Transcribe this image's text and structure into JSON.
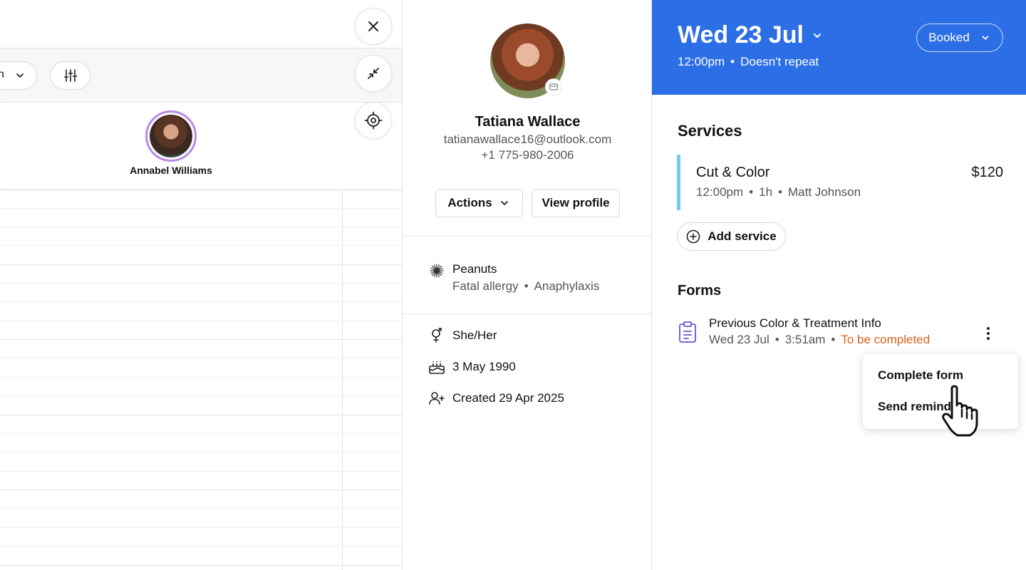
{
  "calendar": {
    "view_label": "h",
    "staff": [
      {
        "name": "Annabel Williams"
      }
    ]
  },
  "client": {
    "name": "Tatiana Wallace",
    "email": "tatianawallace16@outlook.com",
    "phone": "+1 775-980-2006",
    "actions_label": "Actions",
    "view_profile_label": "View profile",
    "allergy": {
      "name": "Peanuts",
      "severity": "Fatal allergy",
      "reaction": "Anaphylaxis"
    },
    "pronouns": "She/Her",
    "birthday": "3 May 1990",
    "created": "Created 29 Apr 2025"
  },
  "appointment": {
    "date": "Wed 23 Jul",
    "time": "12:00pm",
    "repeat": "Doesn't repeat",
    "status": "Booked",
    "header_color": "#2c6ee6",
    "services_title": "Services",
    "services": [
      {
        "name": "Cut & Color",
        "time": "12:00pm",
        "duration": "1h",
        "staff": "Matt Johnson",
        "price": "$120"
      }
    ],
    "add_service_label": "Add service",
    "forms_title": "Forms",
    "forms": [
      {
        "title": "Previous Color & Treatment Info",
        "date": "Wed 23 Jul",
        "time": "3:51am",
        "status": "To be completed",
        "status_color": "#d9601b"
      }
    ],
    "form_menu": [
      "Complete form",
      "Send reminder"
    ]
  }
}
